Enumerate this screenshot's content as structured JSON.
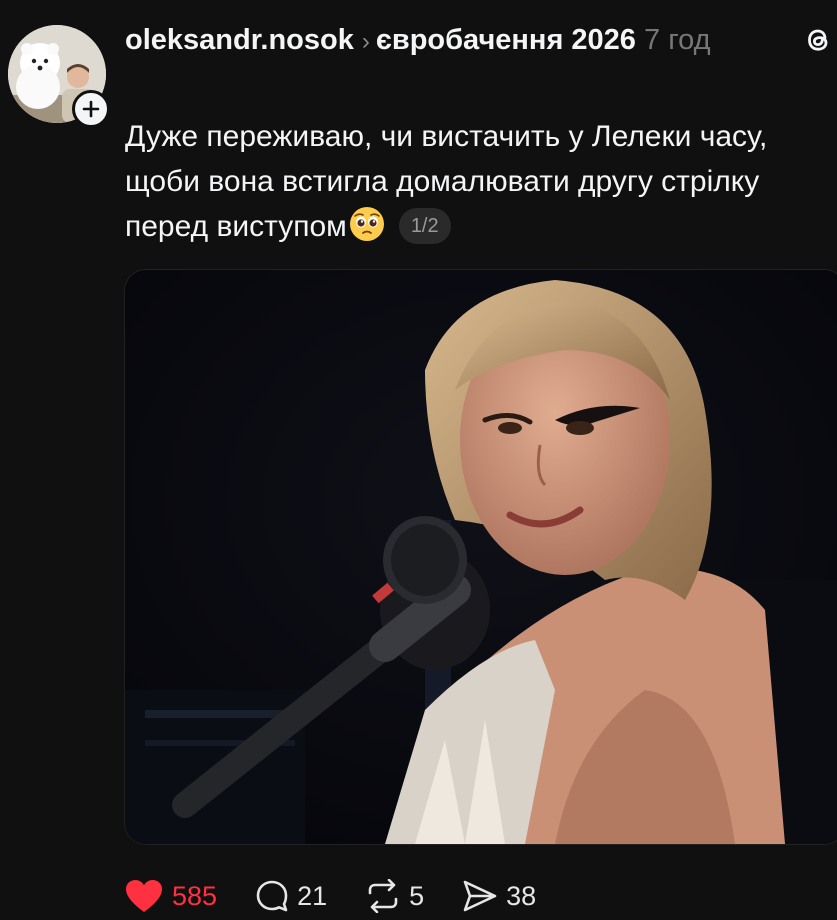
{
  "post": {
    "username": "oleksandr.nosok",
    "topic": "євробачення 2026",
    "time": "7 год",
    "text": "Дуже переживаю, чи вистачить у Лелеки часу, щоби вона встигла домалювати другу стрілку перед виступом",
    "media_counter": "1/2"
  },
  "icons": {
    "avatar": "avatar-with-white-dog",
    "follow": "plus-icon",
    "threads": "threads-logo-icon",
    "emoji": "pleading-face-emoji",
    "like": "heart-icon",
    "comment": "comment-bubble-icon",
    "repost": "repost-icon",
    "share": "send-icon"
  },
  "actions": {
    "likes": "585",
    "comments": "21",
    "reposts": "5",
    "shares": "38"
  },
  "colors": {
    "background": "#101010",
    "text": "#f3f5f7",
    "secondary": "#777777",
    "liked": "#ff3040"
  }
}
